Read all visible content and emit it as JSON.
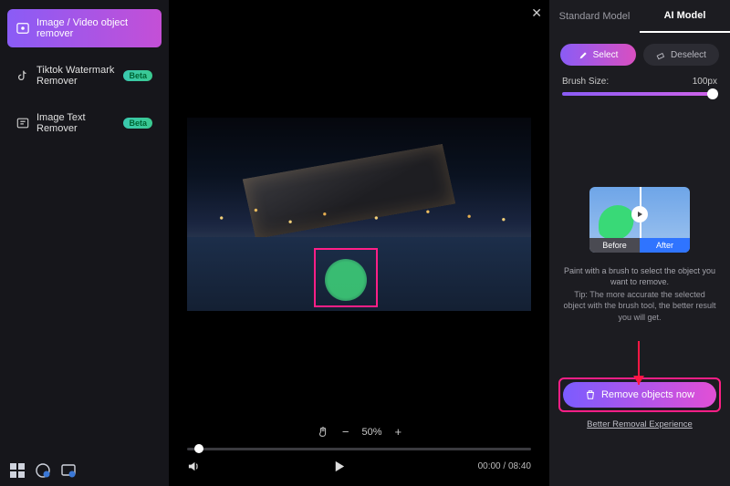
{
  "sidebar": {
    "items": [
      {
        "label": "Image / Video object remover",
        "active": true,
        "badge": null
      },
      {
        "label": "Tiktok Watermark Remover",
        "active": false,
        "badge": "Beta"
      },
      {
        "label": "Image Text Remover",
        "active": false,
        "badge": "Beta"
      }
    ]
  },
  "preview": {
    "zoom": "50%",
    "time_current": "00:00",
    "time_total": "08:40"
  },
  "right": {
    "tabs": {
      "standard": "Standard Model",
      "ai": "AI Model"
    },
    "select_label": "Select",
    "deselect_label": "Deselect",
    "brush_label": "Brush Size:",
    "brush_value": "100px",
    "before_label": "Before",
    "after_label": "After",
    "hint1": "Paint with a brush to select the object you want to remove.",
    "hint2": "Tip: The more accurate the selected object with the brush tool, the better result you will get.",
    "cta": "Remove objects now",
    "link": "Better Removal Experience"
  }
}
